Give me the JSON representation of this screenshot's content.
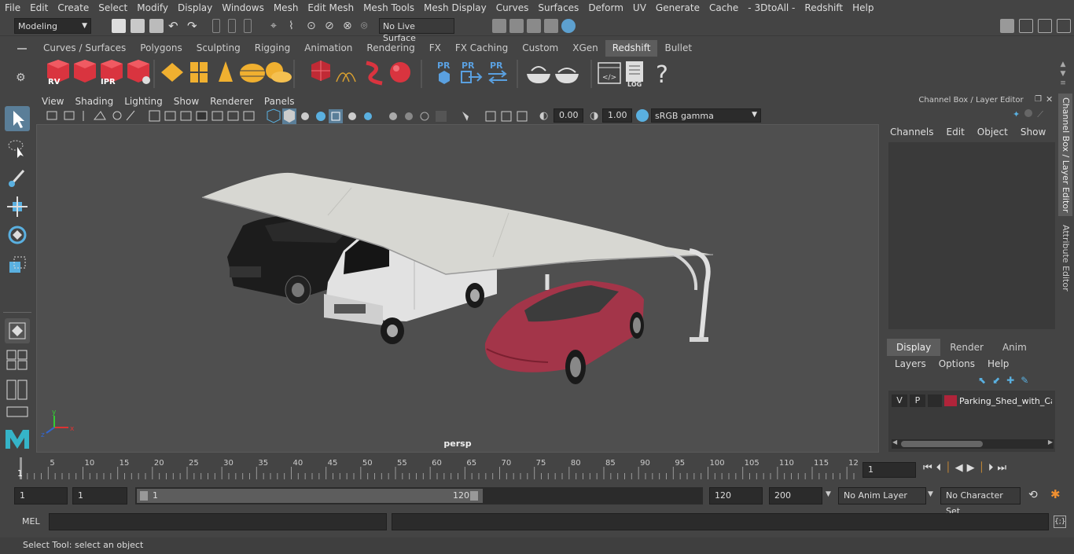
{
  "menu": [
    "File",
    "Edit",
    "Create",
    "Select",
    "Modify",
    "Display",
    "Windows",
    "Mesh",
    "Edit Mesh",
    "Mesh Tools",
    "Mesh Display",
    "Curves",
    "Surfaces",
    "Deform",
    "UV",
    "Generate",
    "Cache",
    "- 3DtoAll -",
    "Redshift",
    "Help"
  ],
  "status": {
    "mode": "Modeling",
    "live_surface": "No Live Surface"
  },
  "shelf_tabs": [
    "Curves / Surfaces",
    "Polygons",
    "Sculpting",
    "Rigging",
    "Animation",
    "Rendering",
    "FX",
    "FX Caching",
    "Custom",
    "XGen",
    "Redshift",
    "Bullet"
  ],
  "shelf_active": "Redshift",
  "shelf_labels": {
    "rv": "RV",
    "ipr": "IPR",
    "pr1": "PR",
    "pr2": "PR",
    "pr3": "PR",
    "log": "LOG",
    "help": "?"
  },
  "viewport": {
    "menu": [
      "View",
      "Shading",
      "Lighting",
      "Show",
      "Renderer",
      "Panels"
    ],
    "exposure": "0.00",
    "gamma": "1.00",
    "color_space": "sRGB gamma",
    "camera_label": "persp"
  },
  "channel_box": {
    "title": "Channel Box / Layer Editor",
    "menu": [
      "Channels",
      "Edit",
      "Object",
      "Show"
    ],
    "side_tabs": [
      "Channel Box / Layer Editor",
      "Attribute Editor"
    ],
    "layer_tabs": [
      "Display",
      "Render",
      "Anim"
    ],
    "layer_active": "Display",
    "layer_menu": [
      "Layers",
      "Options",
      "Help"
    ],
    "layer": {
      "v": "V",
      "p": "P",
      "name": "Parking_Shed_with_Ca",
      "color": "#b0243a"
    }
  },
  "timeline": {
    "ticks": [
      "5",
      "10",
      "15",
      "20",
      "25",
      "30",
      "35",
      "40",
      "45",
      "50",
      "55",
      "60",
      "65",
      "70",
      "75",
      "80",
      "85",
      "90",
      "95",
      "100",
      "105",
      "110",
      "115",
      "12"
    ],
    "start_label": "1",
    "current_frame": "1"
  },
  "range": {
    "start": "1",
    "start2": "1",
    "slider_start": "1",
    "slider_end": "120",
    "end": "120",
    "end2": "200",
    "anim_layer": "No Anim Layer",
    "char_set": "No Character Set"
  },
  "cmdline": {
    "lang": "MEL"
  },
  "help_line": "Select Tool: select an object",
  "colors": {
    "accent": "#5285a6",
    "redshift_red": "#d9343f",
    "bg": "#444444"
  }
}
